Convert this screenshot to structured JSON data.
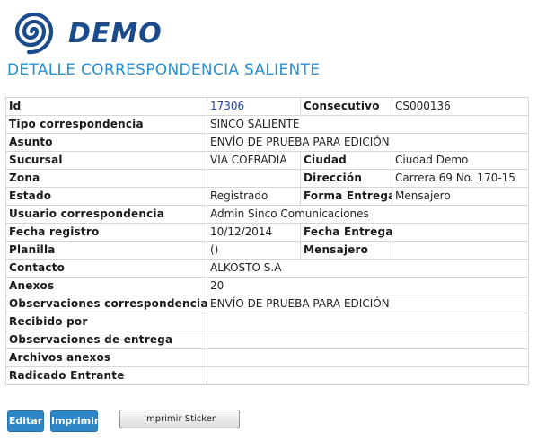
{
  "brand": {
    "logo_text": "DEMO",
    "color": "#1a4b8c"
  },
  "page": {
    "title": "DETALLE CORRESPONDENCIA SALIENTE",
    "title_color": "#2a8fd0"
  },
  "rows": {
    "id": {
      "label": "Id",
      "value": "17306"
    },
    "consecutivo": {
      "label": "Consecutivo",
      "value": "CS000136"
    },
    "tipo": {
      "label": "Tipo correspondencia",
      "value": "SINCO SALIENTE"
    },
    "asunto": {
      "label": "Asunto",
      "value": "ENVÍO DE PRUEBA PARA EDICIÓN"
    },
    "sucursal": {
      "label": "Sucursal",
      "value": "VIA COFRADIA"
    },
    "ciudad": {
      "label": "Ciudad",
      "value": "Ciudad Demo"
    },
    "zona": {
      "label": "Zona",
      "value": ""
    },
    "direccion": {
      "label": "Dirección",
      "value": "Carrera 69 No. 170-15"
    },
    "estado": {
      "label": "Estado",
      "value": "Registrado"
    },
    "forma_entrega": {
      "label": "Forma Entrega",
      "value": "Mensajero"
    },
    "usuario": {
      "label": "Usuario correspondencia",
      "value": "Admin Sinco Comunicaciones"
    },
    "fecha_registro": {
      "label": "Fecha registro",
      "value": "10/12/2014"
    },
    "fecha_entrega": {
      "label": "Fecha Entrega",
      "value": ""
    },
    "planilla": {
      "label": "Planilla",
      "value": "()"
    },
    "mensajero": {
      "label": "Mensajero",
      "value": ""
    },
    "contacto": {
      "label": "Contacto",
      "value": "ALKOSTO S.A"
    },
    "anexos": {
      "label": "Anexos",
      "value": "20"
    },
    "observaciones": {
      "label": "Observaciones correspondencia",
      "value": "ENVÍO DE PRUEBA PARA EDICIÓN"
    },
    "recibido": {
      "label": "Recibido por",
      "value": ""
    },
    "obs_entrega": {
      "label": "Observaciones de entrega",
      "value": ""
    },
    "archivos": {
      "label": "Archivos anexos",
      "value": ""
    },
    "radicado": {
      "label": "Radicado Entrante",
      "value": ""
    }
  },
  "actions": {
    "editar": "Editar",
    "imprimir": "Imprimir",
    "imprimir_sticker": "Imprimir Sticker",
    "button_color": "#2e86c7"
  }
}
